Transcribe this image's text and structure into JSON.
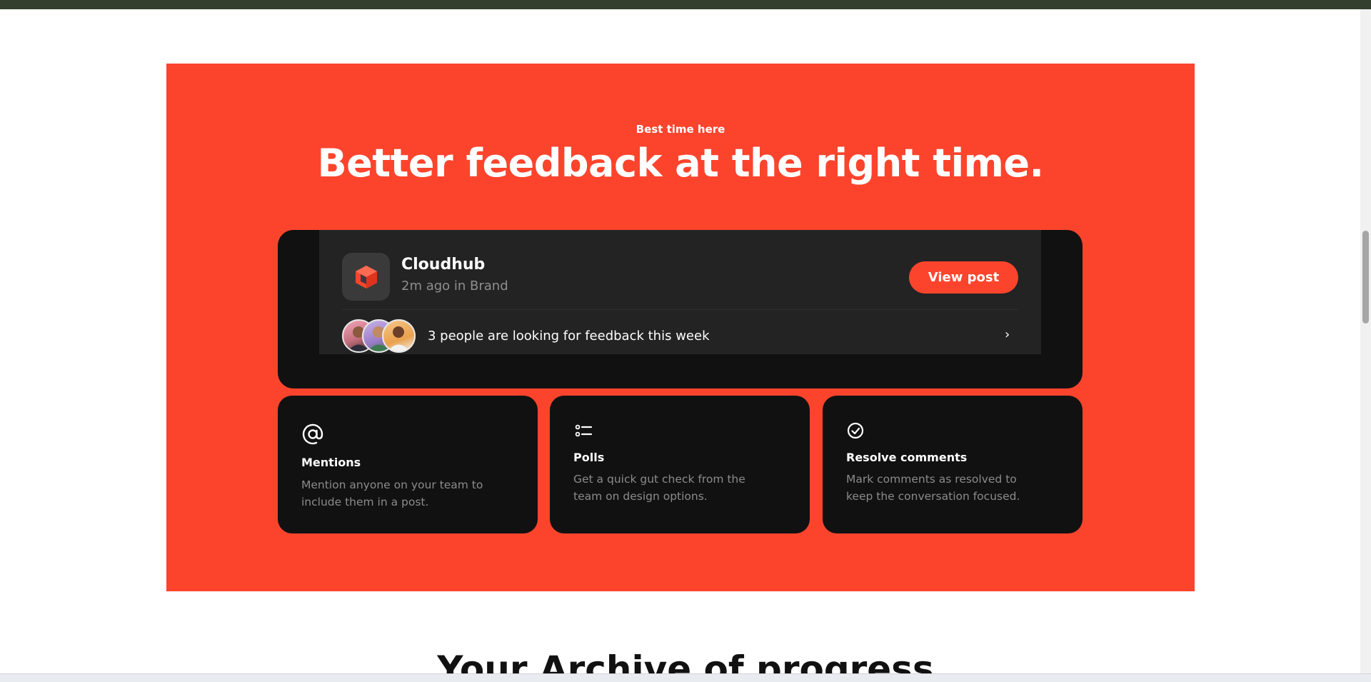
{
  "hero": {
    "eyebrow": "Best time here",
    "headline": "Better feedback at the right time.",
    "background_color": "#fc442d"
  },
  "post": {
    "brand_icon": "cube-icon",
    "brand_name": "Cloudhub",
    "meta": "2m ago in Brand",
    "view_button": "View post",
    "people_text": "3 people are looking for feedback this week",
    "chevron": "›"
  },
  "features": [
    {
      "icon": "at-sign-icon",
      "title": "Mentions",
      "description": "Mention anyone on your team to include them in a post."
    },
    {
      "icon": "list-icon",
      "title": "Polls",
      "description": "Get a quick gut check from the team on design options."
    },
    {
      "icon": "check-circle-icon",
      "title": "Resolve comments",
      "description": "Mark comments as resolved to keep the conversation focused."
    }
  ],
  "next_section": {
    "title": "Your Archive of progress"
  },
  "colors": {
    "accent": "#fc442d",
    "card": "#111111",
    "card_inner": "#232323"
  }
}
